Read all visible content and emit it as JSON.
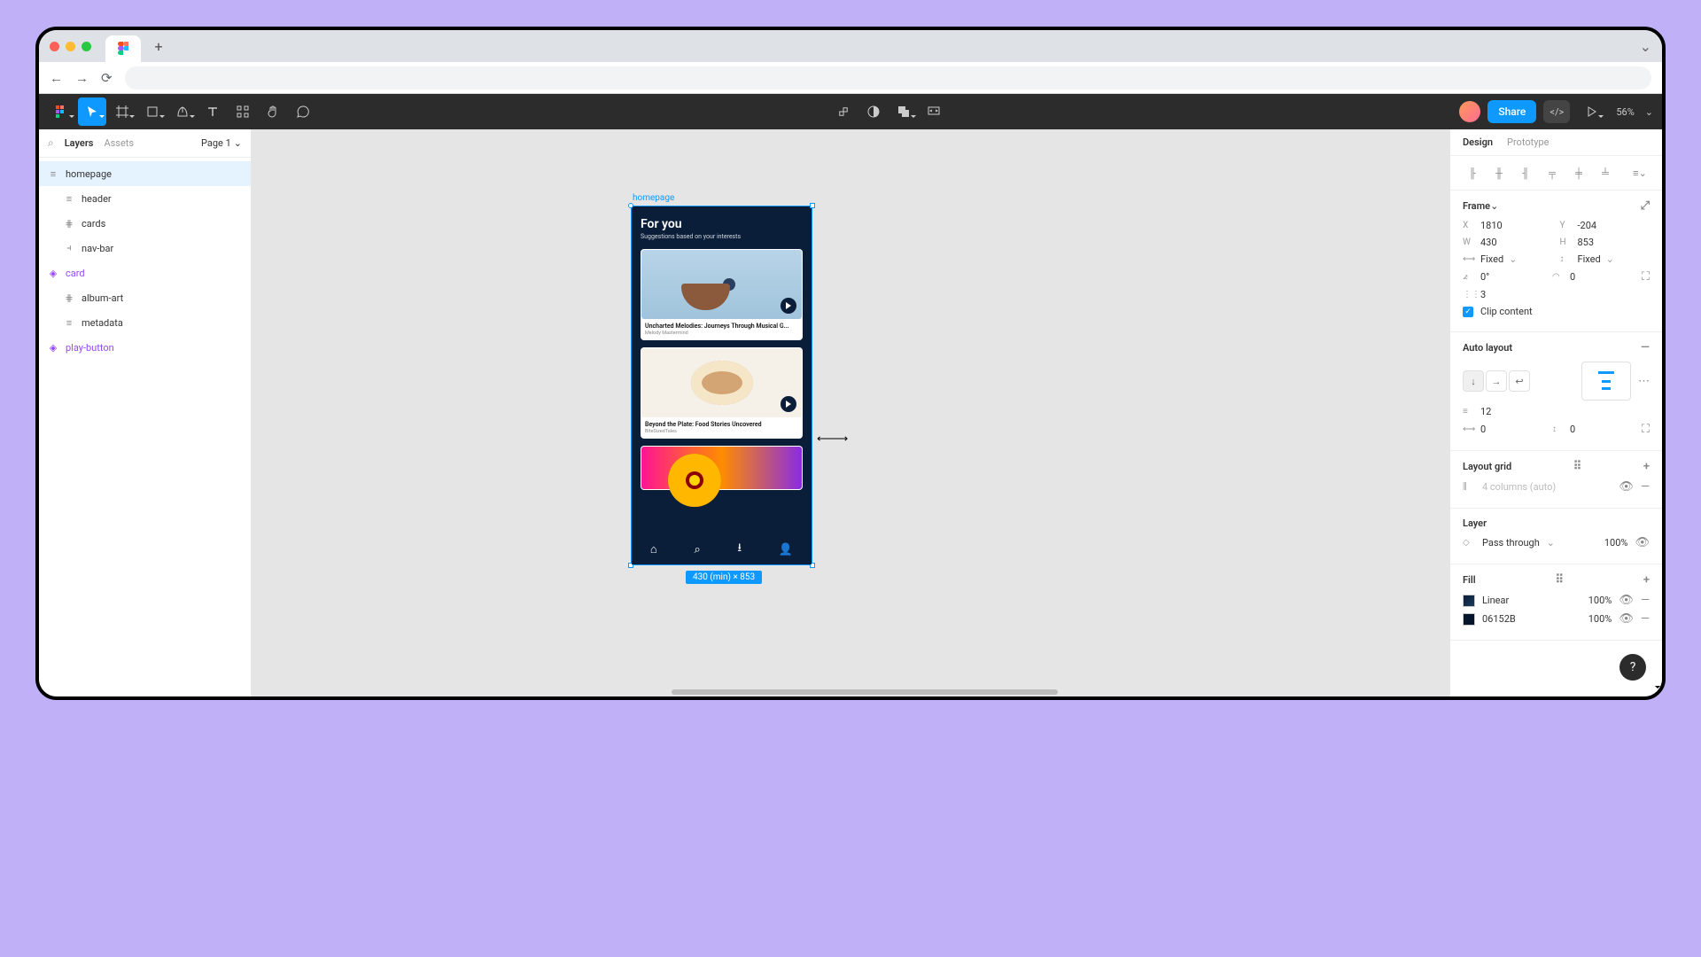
{
  "leftPanel": {
    "tabs": {
      "layers": "Layers",
      "assets": "Assets"
    },
    "pageLabel": "Page 1",
    "tree": {
      "homepage": "homepage",
      "header": "header",
      "cards": "cards",
      "navbar": "nav-bar",
      "card": "card",
      "albumArt": "album-art",
      "metadata": "metadata",
      "playButton": "play-button"
    }
  },
  "toolbar": {
    "shareLabel": "Share",
    "zoom": "56%"
  },
  "canvas": {
    "frameLabel": "homepage",
    "dimensionsBadge": "430 (min) × 853",
    "phone": {
      "title": "For you",
      "subtitle": "Suggestions based on your interests",
      "cards": [
        {
          "title": "Uncharted Melodies: Journeys Through Musical G...",
          "author": "Melody Mastermind"
        },
        {
          "title": "Beyond the Plate: Food Stories Uncovered",
          "author": "BiteSizedTales"
        },
        {
          "title": "",
          "author": ""
        }
      ]
    }
  },
  "rightPanel": {
    "tabs": {
      "design": "Design",
      "prototype": "Prototype"
    },
    "frame": {
      "title": "Frame",
      "x": "1810",
      "y": "-204",
      "w": "430",
      "h": "853",
      "wMode": "Fixed",
      "hMode": "Fixed",
      "rotation": "0°",
      "corner": "0",
      "unknownVal": "3",
      "clipContent": "Clip content"
    },
    "autoLayout": {
      "title": "Auto layout",
      "gap": "12",
      "padH": "0",
      "padV": "0"
    },
    "layoutGrid": {
      "title": "Layout grid",
      "value": "4 columns (auto)"
    },
    "layer": {
      "title": "Layer",
      "blend": "Pass through",
      "opacity": "100%"
    },
    "fill": {
      "title": "Fill",
      "items": [
        {
          "label": "Linear",
          "opacity": "100%"
        },
        {
          "label": "06152B",
          "opacity": "100%"
        }
      ]
    }
  },
  "helpLabel": "?"
}
